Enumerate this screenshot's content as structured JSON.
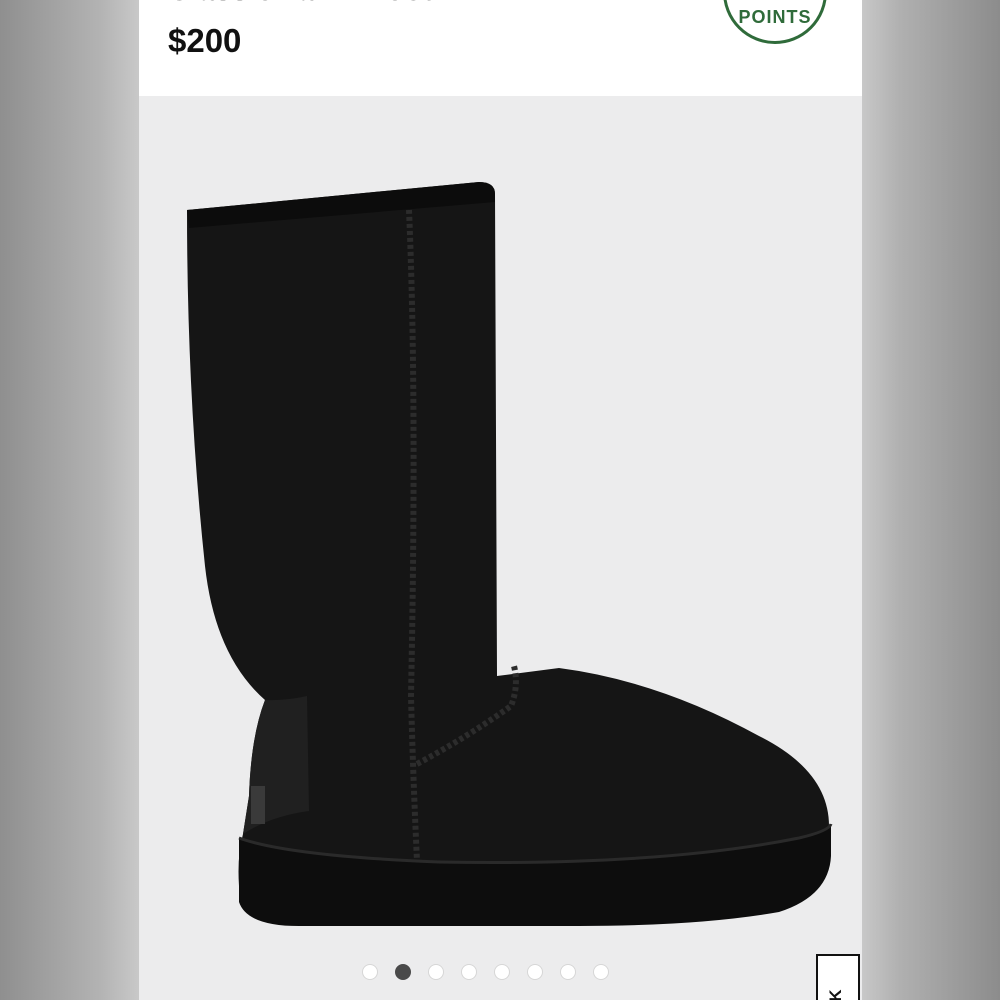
{
  "product": {
    "title": "Classic Tall II Boot",
    "price": "$200"
  },
  "points_badge": {
    "label": "POINTS",
    "color": "#2f6b3a"
  },
  "gallery": {
    "image_description_icon": "boot-photo",
    "dots_total": 8,
    "active_index": 1
  },
  "side_tab": {
    "label": "CK"
  }
}
